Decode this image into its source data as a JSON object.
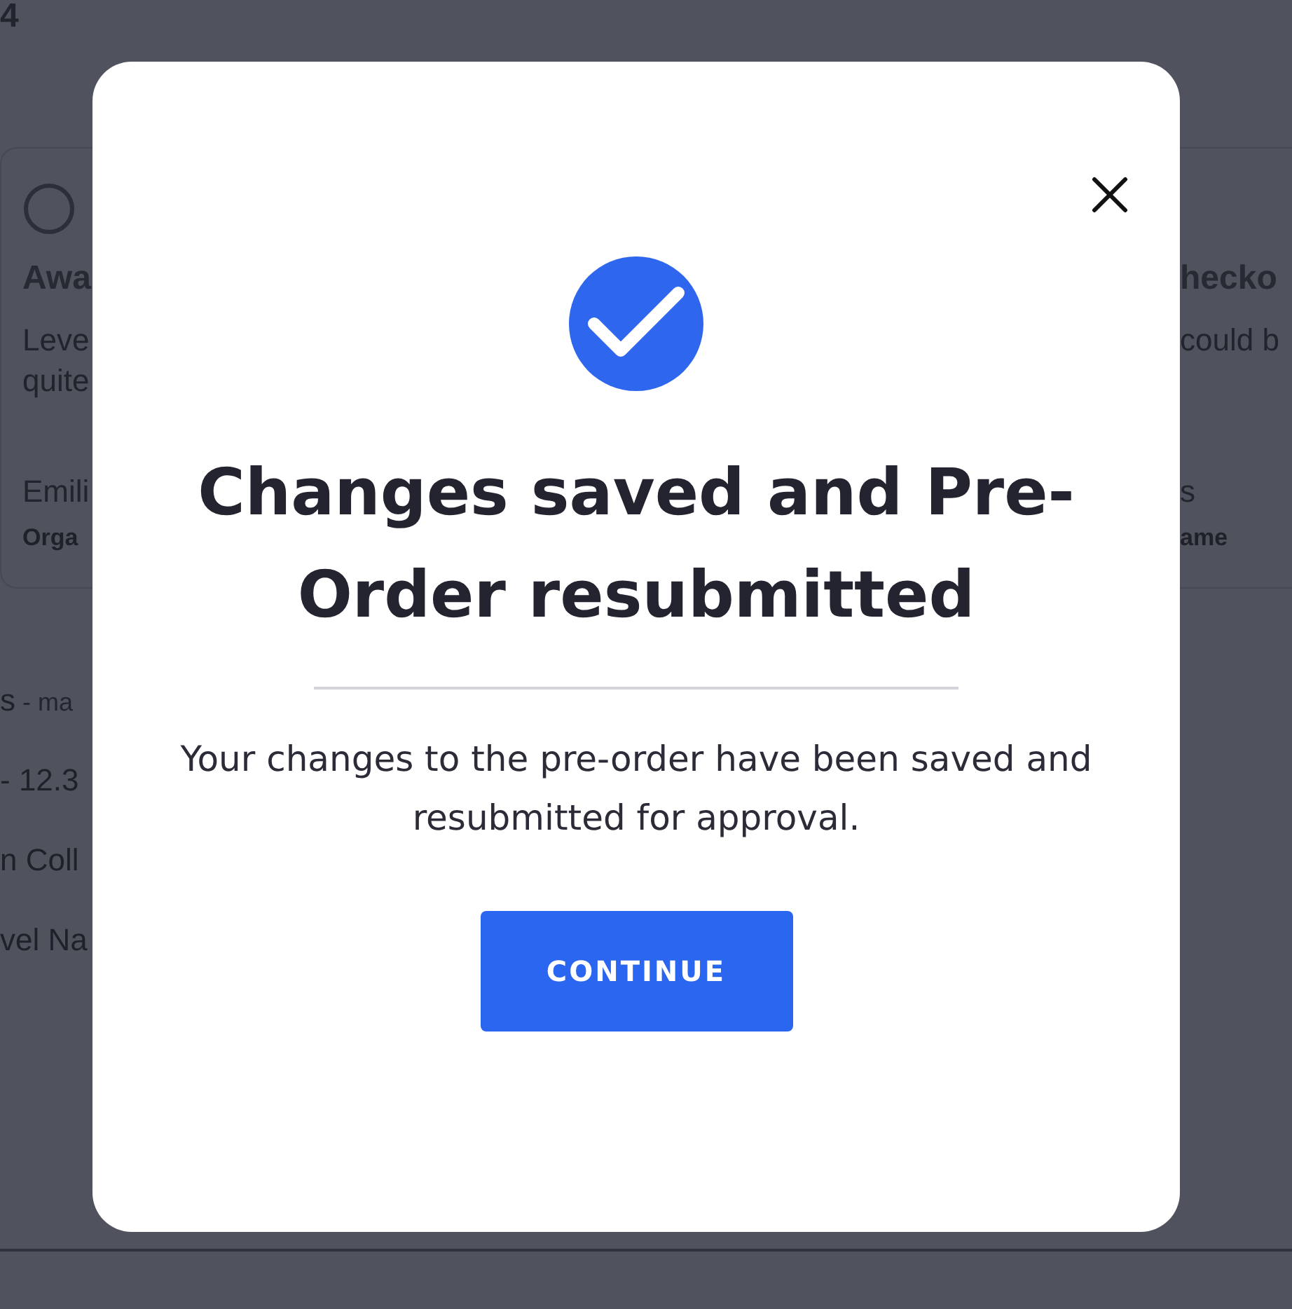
{
  "background": {
    "heading_fragment": "4",
    "left_card": {
      "selected": false,
      "title": "Awa",
      "description_lines": [
        "Leve",
        "quite"
      ],
      "contact": "Emili",
      "organization": "Orga"
    },
    "right_card": {
      "title": "hecko",
      "description": "could b",
      "contact": "s",
      "organization": "ame"
    },
    "details": [
      {
        "label": "s",
        "meta": "- ma"
      },
      {
        "label": "- 12.3"
      },
      {
        "label": "n Coll"
      },
      {
        "label": "vel Na"
      }
    ]
  },
  "modal": {
    "title": "Changes saved and Pre-Order resubmitted",
    "message": "Your changes to the pre-order have been saved and resubmitted for approval.",
    "button": "CONTINUE"
  }
}
